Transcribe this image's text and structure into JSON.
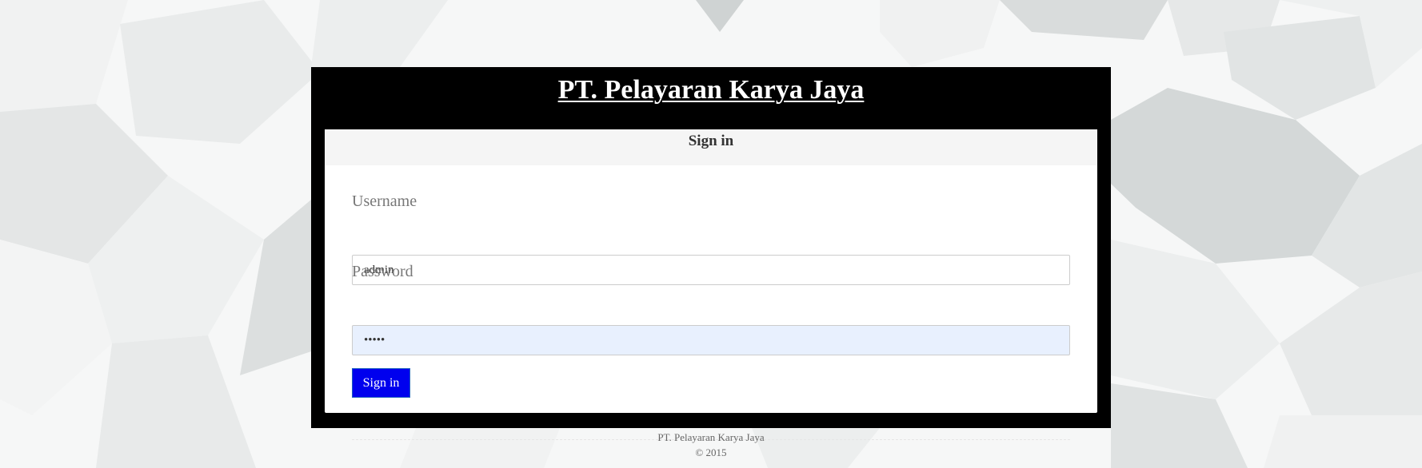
{
  "header": {
    "title": "PT. Pelayaran Karya Jaya"
  },
  "login_panel": {
    "heading": "Sign in",
    "username": {
      "label": "Username",
      "value": "admin"
    },
    "password": {
      "label": "Password",
      "value": "•••••"
    },
    "submit_label": "Sign in"
  },
  "footer": {
    "company": "PT. Pelayaran Karya Jaya",
    "copyright": "© 2015"
  },
  "colors": {
    "card_background": "#000000",
    "button_background": "#0000ee",
    "autofill_background": "#e8f0fe",
    "panel_heading_background": "#f5f5f5"
  }
}
